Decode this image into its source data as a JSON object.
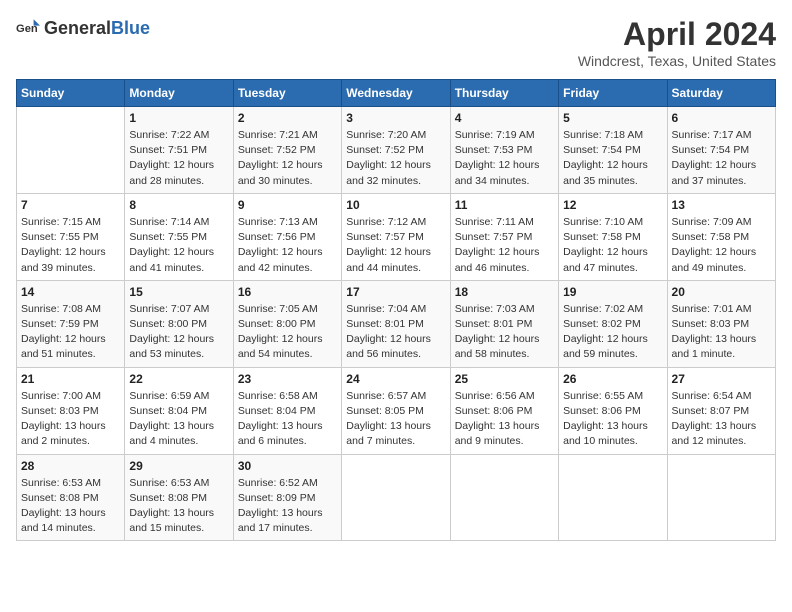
{
  "header": {
    "logo_general": "General",
    "logo_blue": "Blue",
    "title": "April 2024",
    "location": "Windcrest, Texas, United States"
  },
  "weekdays": [
    "Sunday",
    "Monday",
    "Tuesday",
    "Wednesday",
    "Thursday",
    "Friday",
    "Saturday"
  ],
  "weeks": [
    [
      {
        "day": "",
        "sunrise": "",
        "sunset": "",
        "daylight": ""
      },
      {
        "day": "1",
        "sunrise": "Sunrise: 7:22 AM",
        "sunset": "Sunset: 7:51 PM",
        "daylight": "Daylight: 12 hours and 28 minutes."
      },
      {
        "day": "2",
        "sunrise": "Sunrise: 7:21 AM",
        "sunset": "Sunset: 7:52 PM",
        "daylight": "Daylight: 12 hours and 30 minutes."
      },
      {
        "day": "3",
        "sunrise": "Sunrise: 7:20 AM",
        "sunset": "Sunset: 7:52 PM",
        "daylight": "Daylight: 12 hours and 32 minutes."
      },
      {
        "day": "4",
        "sunrise": "Sunrise: 7:19 AM",
        "sunset": "Sunset: 7:53 PM",
        "daylight": "Daylight: 12 hours and 34 minutes."
      },
      {
        "day": "5",
        "sunrise": "Sunrise: 7:18 AM",
        "sunset": "Sunset: 7:54 PM",
        "daylight": "Daylight: 12 hours and 35 minutes."
      },
      {
        "day": "6",
        "sunrise": "Sunrise: 7:17 AM",
        "sunset": "Sunset: 7:54 PM",
        "daylight": "Daylight: 12 hours and 37 minutes."
      }
    ],
    [
      {
        "day": "7",
        "sunrise": "Sunrise: 7:15 AM",
        "sunset": "Sunset: 7:55 PM",
        "daylight": "Daylight: 12 hours and 39 minutes."
      },
      {
        "day": "8",
        "sunrise": "Sunrise: 7:14 AM",
        "sunset": "Sunset: 7:55 PM",
        "daylight": "Daylight: 12 hours and 41 minutes."
      },
      {
        "day": "9",
        "sunrise": "Sunrise: 7:13 AM",
        "sunset": "Sunset: 7:56 PM",
        "daylight": "Daylight: 12 hours and 42 minutes."
      },
      {
        "day": "10",
        "sunrise": "Sunrise: 7:12 AM",
        "sunset": "Sunset: 7:57 PM",
        "daylight": "Daylight: 12 hours and 44 minutes."
      },
      {
        "day": "11",
        "sunrise": "Sunrise: 7:11 AM",
        "sunset": "Sunset: 7:57 PM",
        "daylight": "Daylight: 12 hours and 46 minutes."
      },
      {
        "day": "12",
        "sunrise": "Sunrise: 7:10 AM",
        "sunset": "Sunset: 7:58 PM",
        "daylight": "Daylight: 12 hours and 47 minutes."
      },
      {
        "day": "13",
        "sunrise": "Sunrise: 7:09 AM",
        "sunset": "Sunset: 7:58 PM",
        "daylight": "Daylight: 12 hours and 49 minutes."
      }
    ],
    [
      {
        "day": "14",
        "sunrise": "Sunrise: 7:08 AM",
        "sunset": "Sunset: 7:59 PM",
        "daylight": "Daylight: 12 hours and 51 minutes."
      },
      {
        "day": "15",
        "sunrise": "Sunrise: 7:07 AM",
        "sunset": "Sunset: 8:00 PM",
        "daylight": "Daylight: 12 hours and 53 minutes."
      },
      {
        "day": "16",
        "sunrise": "Sunrise: 7:05 AM",
        "sunset": "Sunset: 8:00 PM",
        "daylight": "Daylight: 12 hours and 54 minutes."
      },
      {
        "day": "17",
        "sunrise": "Sunrise: 7:04 AM",
        "sunset": "Sunset: 8:01 PM",
        "daylight": "Daylight: 12 hours and 56 minutes."
      },
      {
        "day": "18",
        "sunrise": "Sunrise: 7:03 AM",
        "sunset": "Sunset: 8:01 PM",
        "daylight": "Daylight: 12 hours and 58 minutes."
      },
      {
        "day": "19",
        "sunrise": "Sunrise: 7:02 AM",
        "sunset": "Sunset: 8:02 PM",
        "daylight": "Daylight: 12 hours and 59 minutes."
      },
      {
        "day": "20",
        "sunrise": "Sunrise: 7:01 AM",
        "sunset": "Sunset: 8:03 PM",
        "daylight": "Daylight: 13 hours and 1 minute."
      }
    ],
    [
      {
        "day": "21",
        "sunrise": "Sunrise: 7:00 AM",
        "sunset": "Sunset: 8:03 PM",
        "daylight": "Daylight: 13 hours and 2 minutes."
      },
      {
        "day": "22",
        "sunrise": "Sunrise: 6:59 AM",
        "sunset": "Sunset: 8:04 PM",
        "daylight": "Daylight: 13 hours and 4 minutes."
      },
      {
        "day": "23",
        "sunrise": "Sunrise: 6:58 AM",
        "sunset": "Sunset: 8:04 PM",
        "daylight": "Daylight: 13 hours and 6 minutes."
      },
      {
        "day": "24",
        "sunrise": "Sunrise: 6:57 AM",
        "sunset": "Sunset: 8:05 PM",
        "daylight": "Daylight: 13 hours and 7 minutes."
      },
      {
        "day": "25",
        "sunrise": "Sunrise: 6:56 AM",
        "sunset": "Sunset: 8:06 PM",
        "daylight": "Daylight: 13 hours and 9 minutes."
      },
      {
        "day": "26",
        "sunrise": "Sunrise: 6:55 AM",
        "sunset": "Sunset: 8:06 PM",
        "daylight": "Daylight: 13 hours and 10 minutes."
      },
      {
        "day": "27",
        "sunrise": "Sunrise: 6:54 AM",
        "sunset": "Sunset: 8:07 PM",
        "daylight": "Daylight: 13 hours and 12 minutes."
      }
    ],
    [
      {
        "day": "28",
        "sunrise": "Sunrise: 6:53 AM",
        "sunset": "Sunset: 8:08 PM",
        "daylight": "Daylight: 13 hours and 14 minutes."
      },
      {
        "day": "29",
        "sunrise": "Sunrise: 6:53 AM",
        "sunset": "Sunset: 8:08 PM",
        "daylight": "Daylight: 13 hours and 15 minutes."
      },
      {
        "day": "30",
        "sunrise": "Sunrise: 6:52 AM",
        "sunset": "Sunset: 8:09 PM",
        "daylight": "Daylight: 13 hours and 17 minutes."
      },
      {
        "day": "",
        "sunrise": "",
        "sunset": "",
        "daylight": ""
      },
      {
        "day": "",
        "sunrise": "",
        "sunset": "",
        "daylight": ""
      },
      {
        "day": "",
        "sunrise": "",
        "sunset": "",
        "daylight": ""
      },
      {
        "day": "",
        "sunrise": "",
        "sunset": "",
        "daylight": ""
      }
    ]
  ]
}
